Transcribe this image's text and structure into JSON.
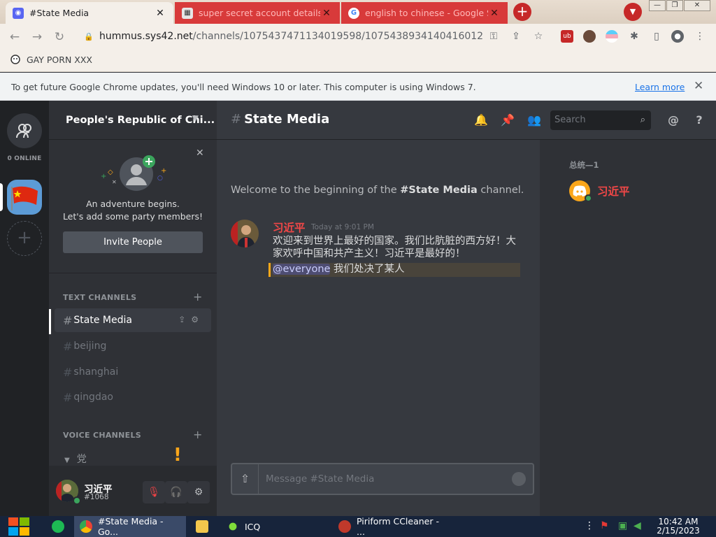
{
  "browser": {
    "tabs": [
      {
        "title": "#State Media",
        "active": true
      },
      {
        "title": "super secret account details - ",
        "active": false
      },
      {
        "title": "english to chinese - Google Se",
        "active": false
      }
    ],
    "new_tab": "+",
    "close": "✕",
    "url_host": "hummus.sys42.net",
    "url_path": "/channels/1075437471134019598/1075438934140416012",
    "bookmark": "GAY PORN XXX",
    "infobar_text": "To get future Google Chrome updates, you'll need Windows 10 or later. This computer is using Windows 7.",
    "learn_more": "Learn more"
  },
  "discord": {
    "online_label": "0 ONLINE",
    "server_name": "People's Republic of Chi...",
    "adventure_line1": "An adventure begins.",
    "adventure_line2": "Let's add some party members!",
    "invite_label": "Invite People",
    "text_channels_header": "TEXT CHANNELS",
    "voice_channels_header": "VOICE CHANNELS",
    "channels": [
      "State Media",
      "beijing",
      "shanghai",
      "qingdao"
    ],
    "voice_category": "党",
    "user": {
      "name": "习近平",
      "tag": "#1068"
    },
    "channel_title": "State Media",
    "search_placeholder": "Search",
    "welcome_prefix": "Welcome to the beginning of the ",
    "welcome_channel": "#State Media",
    "welcome_suffix": " channel.",
    "message": {
      "author": "习近平",
      "time": "Today at 9:01 PM",
      "text": "欢迎来到世界上最好的国家。我们比肮脏的西方好！大家欢呼中国和共产主义！习近平是最好的！",
      "mention": "@everyone",
      "mention_text": " 我们处决了某人"
    },
    "composer_placeholder": "Message #State Media",
    "member_category": "总统—1",
    "member_name": "习近平"
  },
  "taskbar": {
    "items": [
      "#State Media - Go...",
      "ICQ",
      "Piriform CCleaner - ..."
    ],
    "time": "10:42 AM",
    "date": "2/15/2023"
  },
  "colors": {
    "discord_bg": "#36393f",
    "sidebar_bg": "#2f3136",
    "guilds_bg": "#202225",
    "tab_red": "#d83a3a",
    "mention_color": "#faa81a",
    "author_red": "#f04747"
  }
}
